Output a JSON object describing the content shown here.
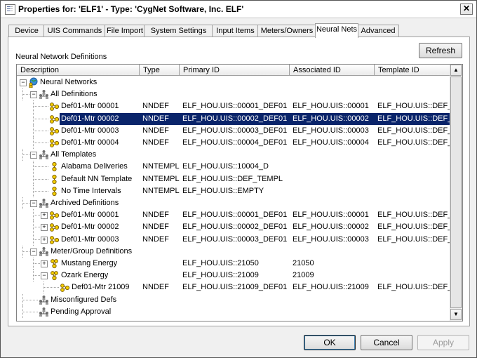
{
  "window": {
    "title": "Properties for: 'ELF1' - Type: 'CygNet Software, Inc. ELF'",
    "close_glyph": "✕"
  },
  "tabs": [
    {
      "label": "Device"
    },
    {
      "label": "UIS Commands"
    },
    {
      "label": "File Import"
    },
    {
      "label": "System Settings"
    },
    {
      "label": "Input Items"
    },
    {
      "label": "Meters/Owners"
    },
    {
      "label": "Neural Nets",
      "active": true
    },
    {
      "label": "Advanced"
    }
  ],
  "panel": {
    "group_label": "Neural Network Definitions",
    "refresh_label": "Refresh"
  },
  "list": {
    "columns": [
      "Description",
      "Type",
      "Primary ID",
      "Associated ID",
      "Template ID"
    ],
    "rows": [
      {
        "level": 0,
        "icon": "globe-person-icon",
        "expander": "minus",
        "description": "Neural Networks",
        "type": "",
        "primary_id": "",
        "associated_id": "",
        "template_id": ""
      },
      {
        "level": 1,
        "icon": "group-icon",
        "expander": "minus",
        "description": "All Definitions",
        "type": "",
        "primary_id": "",
        "associated_id": "",
        "template_id": ""
      },
      {
        "level": 2,
        "icon": "definition-icon",
        "expander": "none",
        "description": "Def01-Mtr 00001",
        "type": "NNDEF",
        "primary_id": "ELF_HOU.UIS::00001_DEF01",
        "associated_id": "ELF_HOU.UIS::00001",
        "template_id": "ELF_HOU.UIS::DEF_"
      },
      {
        "level": 2,
        "icon": "definition-icon",
        "expander": "none",
        "description": "Def01-Mtr 00002",
        "type": "NNDEF",
        "primary_id": "ELF_HOU.UIS::00002_DEF01",
        "associated_id": "ELF_HOU.UIS::00002",
        "template_id": "ELF_HOU.UIS::DEF_",
        "selected": true
      },
      {
        "level": 2,
        "icon": "definition-icon",
        "expander": "none",
        "description": "Def01-Mtr 00003",
        "type": "NNDEF",
        "primary_id": "ELF_HOU.UIS::00003_DEF01",
        "associated_id": "ELF_HOU.UIS::00003",
        "template_id": "ELF_HOU.UIS::DEF_"
      },
      {
        "level": 2,
        "icon": "definition-icon",
        "expander": "none",
        "description": "Def01-Mtr 00004",
        "type": "NNDEF",
        "primary_id": "ELF_HOU.UIS::00004_DEF01",
        "associated_id": "ELF_HOU.UIS::00004",
        "template_id": "ELF_HOU.UIS::DEF_"
      },
      {
        "level": 1,
        "icon": "group-icon",
        "expander": "minus",
        "description": "All Templates",
        "type": "",
        "primary_id": "",
        "associated_id": "",
        "template_id": ""
      },
      {
        "level": 2,
        "icon": "template-icon",
        "expander": "none",
        "description": "Alabama Deliveries",
        "type": "NNTEMPL",
        "primary_id": "ELF_HOU.UIS::10004_D",
        "associated_id": "",
        "template_id": ""
      },
      {
        "level": 2,
        "icon": "template-icon",
        "expander": "none",
        "description": "Default NN Template",
        "type": "NNTEMPL",
        "primary_id": "ELF_HOU.UIS::DEF_TEMPL",
        "associated_id": "",
        "template_id": ""
      },
      {
        "level": 2,
        "icon": "template-icon",
        "expander": "none",
        "description": "No Time Intervals",
        "type": "NNTEMPL",
        "primary_id": "ELF_HOU.UIS::EMPTY",
        "associated_id": "",
        "template_id": ""
      },
      {
        "level": 1,
        "icon": "group-icon",
        "expander": "minus",
        "description": "Archived Definitions",
        "type": "",
        "primary_id": "",
        "associated_id": "",
        "template_id": ""
      },
      {
        "level": 2,
        "icon": "definition-icon",
        "expander": "plus",
        "description": "Def01-Mtr 00001",
        "type": "NNDEF",
        "primary_id": "ELF_HOU.UIS::00001_DEF01",
        "associated_id": "ELF_HOU.UIS::00001",
        "template_id": "ELF_HOU.UIS::DEF_"
      },
      {
        "level": 2,
        "icon": "definition-icon",
        "expander": "plus",
        "description": "Def01-Mtr 00002",
        "type": "NNDEF",
        "primary_id": "ELF_HOU.UIS::00002_DEF01",
        "associated_id": "ELF_HOU.UIS::00002",
        "template_id": "ELF_HOU.UIS::DEF_"
      },
      {
        "level": 2,
        "icon": "definition-icon",
        "expander": "plus",
        "description": "Def01-Mtr 00003",
        "type": "NNDEF",
        "primary_id": "ELF_HOU.UIS::00003_DEF01",
        "associated_id": "ELF_HOU.UIS::00003",
        "template_id": "ELF_HOU.UIS::DEF_"
      },
      {
        "level": 1,
        "icon": "group-icon",
        "expander": "minus",
        "description": "Meter/Group Definitions",
        "type": "",
        "primary_id": "",
        "associated_id": "",
        "template_id": ""
      },
      {
        "level": 2,
        "icon": "meter-icon",
        "expander": "plus",
        "description": "Mustang Energy",
        "type": "",
        "primary_id": "ELF_HOU.UIS::21050",
        "associated_id": "21050",
        "template_id": ""
      },
      {
        "level": 2,
        "icon": "meter-icon",
        "expander": "minus",
        "description": "Ozark Energy",
        "type": "",
        "primary_id": "ELF_HOU.UIS::21009",
        "associated_id": "21009",
        "template_id": ""
      },
      {
        "level": 3,
        "icon": "definition-icon",
        "expander": "none",
        "description": "Def01-Mtr 21009",
        "type": "NNDEF",
        "primary_id": "ELF_HOU.UIS::21009_DEF01",
        "associated_id": "ELF_HOU.UIS::21009",
        "template_id": "ELF_HOU.UIS::DEF_"
      },
      {
        "level": 1,
        "icon": "group-icon",
        "expander": "none",
        "description": "Misconfigured Defs",
        "type": "",
        "primary_id": "",
        "associated_id": "",
        "template_id": ""
      },
      {
        "level": 1,
        "icon": "group-icon",
        "expander": "none",
        "description": "Pending Approval",
        "type": "",
        "primary_id": "",
        "associated_id": "",
        "template_id": ""
      }
    ]
  },
  "footer": {
    "ok_label": "OK",
    "cancel_label": "Cancel",
    "apply_label": "Apply"
  },
  "colors": {
    "selection": "#0a246a",
    "icon_yellow": "#f5d000"
  }
}
